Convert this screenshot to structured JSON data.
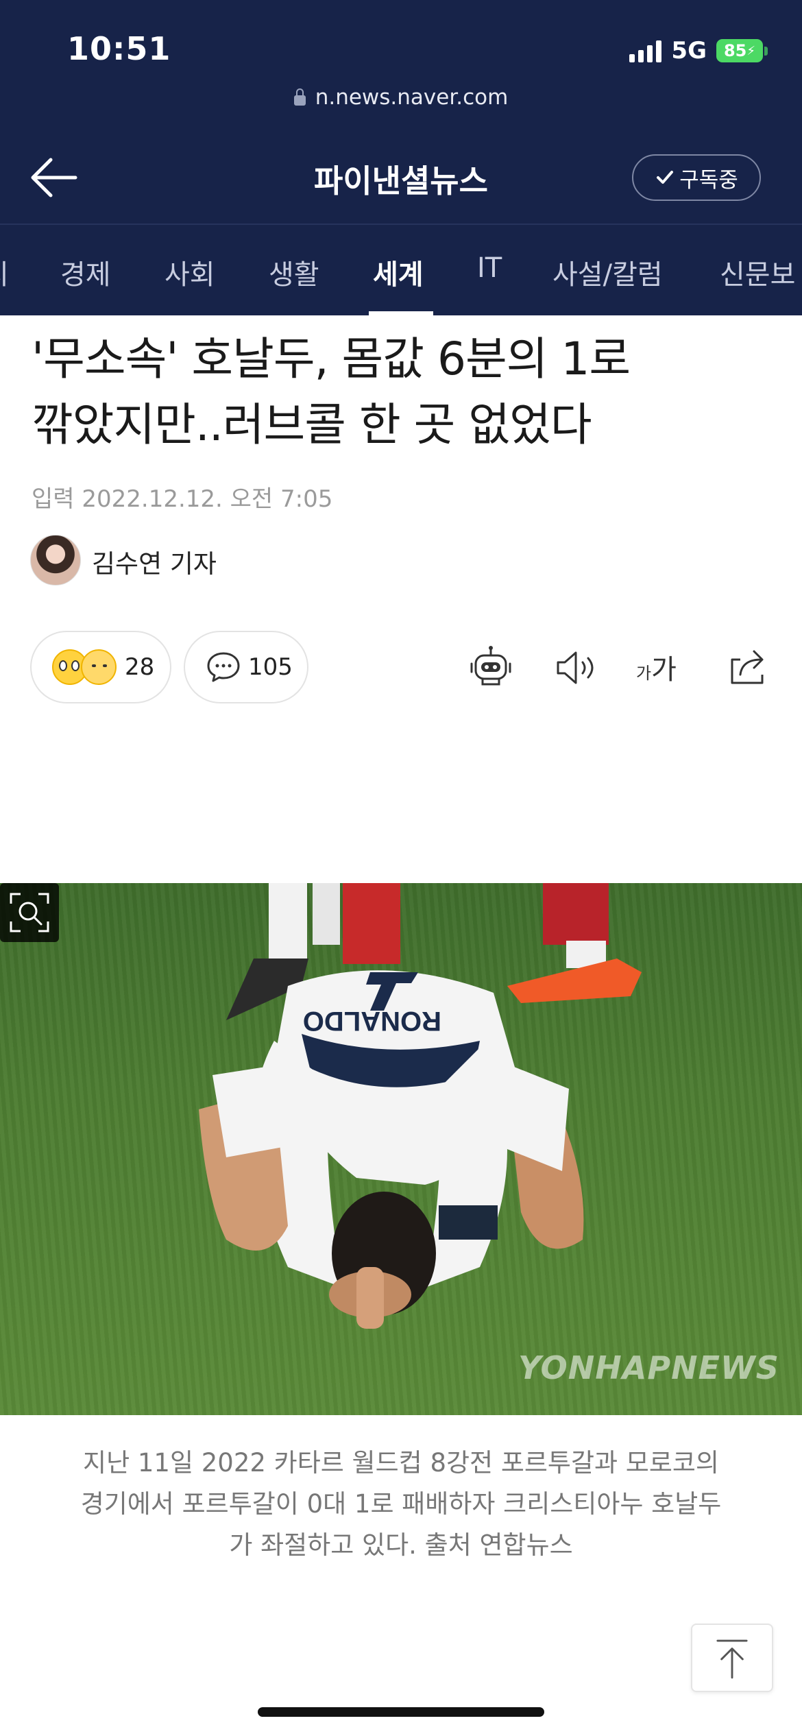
{
  "status_bar": {
    "time": "10:51",
    "network": "5G",
    "battery": "85"
  },
  "browser": {
    "url": "n.news.naver.com"
  },
  "header": {
    "title": "파이낸셜뉴스",
    "subscribe_label": "구독중"
  },
  "tabs": [
    {
      "label": "지",
      "active": false
    },
    {
      "label": "경제",
      "active": false
    },
    {
      "label": "사회",
      "active": false
    },
    {
      "label": "생활",
      "active": false
    },
    {
      "label": "세계",
      "active": true
    },
    {
      "label": "IT",
      "active": false
    },
    {
      "label": "사설/칼럼",
      "active": false
    },
    {
      "label": "신문보"
    }
  ],
  "article": {
    "headline_line1": "'무소속' 호날두, 몸값 6분의 1로",
    "headline_line2": "깎았지만..러브콜 한 곳 없었다",
    "date": "입력 2022.12.12. 오전 7:05",
    "reporter": "김수연 기자",
    "reaction_count": "28",
    "comment_count": "105",
    "font_small": "가",
    "font_large": "가",
    "photo_watermark": "YONHAPNEWS",
    "photo_jersey_name": "RONALDO",
    "photo_jersey_number": "7",
    "caption_line1": "지난 11일 2022 카타르 월드컵 8강전 포르투갈과 모로코의",
    "caption_line2": "경기에서 포르투갈이 0대 1로 패배하자 크리스티아누 호날두",
    "caption_line3": "가 좌절하고 있다. 출처 연합뉴스"
  },
  "colors": {
    "header_bg": "#172349",
    "battery": "#4cd964"
  },
  "icons": [
    "lock-icon",
    "back-arrow-icon",
    "check-icon",
    "comment-icon",
    "robot-summary-icon",
    "speaker-icon",
    "share-icon",
    "zoom-icon",
    "scroll-top-icon"
  ]
}
